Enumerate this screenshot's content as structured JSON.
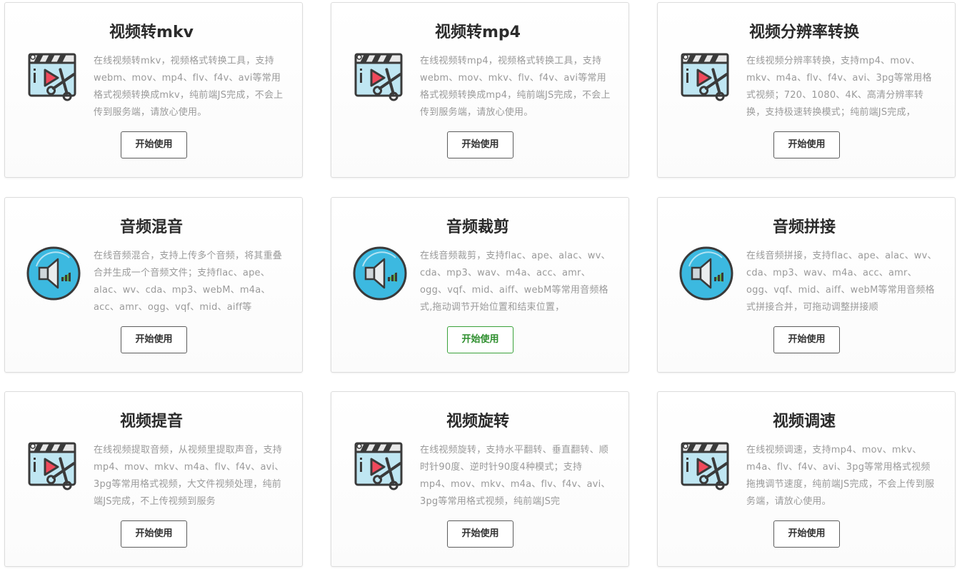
{
  "cards": [
    {
      "title": "视频转mkv",
      "icon": "video-scissors-icon",
      "desc": "在线视频转mkv，视频格式转换工具，支持webm、mov、mp4、flv、f4v、avi等常用格式视频转换成mkv，纯前端JS完成，不会上传到服务端，请放心使用。",
      "button": "开始使用"
    },
    {
      "title": "视频转mp4",
      "icon": "video-scissors-icon",
      "desc": "在线视频转mp4，视频格式转换工具，支持webm、mov、mkv、flv、f4v、avi等常用格式视频转换成mp4，纯前端JS完成，不会上传到服务端，请放心使用。",
      "button": "开始使用"
    },
    {
      "title": "视频分辨率转换",
      "icon": "video-scissors-icon",
      "desc": "在线视频分辨率转换，支持mp4、mov、mkv、m4a、flv、f4v、avi、3pg等常用格式视频；720、1080、4K、高清分辨率转换，支持极速转换模式；纯前端JS完成，",
      "button": "开始使用"
    },
    {
      "title": "音频混音",
      "icon": "audio-speaker-icon",
      "desc": "在线音频混合，支持上传多个音频，将其重叠合并生成一个音频文件；支持flac、ape、alac、wv、cda、mp3、webM、m4a、acc、amr、ogg、vqf、mid、aiff等",
      "button": "开始使用"
    },
    {
      "title": "音频裁剪",
      "icon": "audio-speaker-icon",
      "desc": "在线音频裁剪，支持flac、ape、alac、wv、cda、mp3、wav、m4a、acc、amr、ogg、vqf、mid、aiff、webM等常用音频格式,拖动调节开始位置和结束位置，",
      "button": "开始使用",
      "active": true
    },
    {
      "title": "音频拼接",
      "icon": "audio-speaker-icon",
      "desc": "在线音频拼接，支持flac、ape、alac、wv、cda、mp3、wav、m4a、acc、amr、ogg、vqf、mid、aiff、webM等常用音频格式拼接合并，可拖动调整拼接顺",
      "button": "开始使用"
    },
    {
      "title": "视频提音",
      "icon": "video-scissors-icon",
      "desc": "在线视频提取音频，从视频里提取声音，支持mp4、mov、mkv、m4a、flv、f4v、avi、3pg等常用格式视频，大文件视频处理，纯前端JS完成，不上传视频到服务",
      "button": "开始使用"
    },
    {
      "title": "视频旋转",
      "icon": "video-scissors-icon",
      "desc": "在线视频旋转，支持水平翻转、垂直翻转、顺时针90度、逆时针90度4种模式；支持mp4、mov、mkv、m4a、flv、f4v、avi、3pg等常用格式视频，纯前端JS完",
      "button": "开始使用"
    },
    {
      "title": "视频调速",
      "icon": "video-scissors-icon",
      "desc": "在线视频调速，支持mp4、mov、mkv、m4a、flv、f4v、avi、3pg等常用格式视频拖拽调节速度，纯前端JS完成，不会上传到服务端，请放心使用。",
      "button": "开始使用"
    }
  ],
  "colors": {
    "button_border": "#5c5c5c",
    "button_active": "#3aa23a",
    "speaker_circle": "#3cb9e0",
    "video_screen": "#bfe6f2",
    "play_red": "#f0495c"
  }
}
